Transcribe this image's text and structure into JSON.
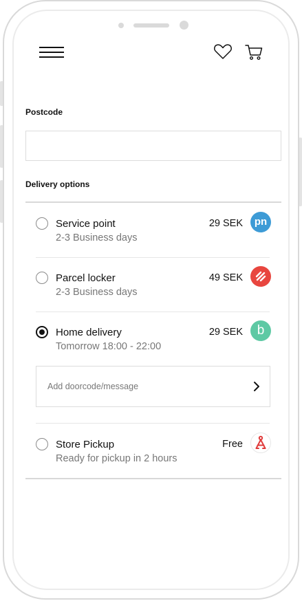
{
  "header": {
    "menu_icon": "hamburger-menu-icon",
    "favorites_icon": "heart-icon",
    "cart_icon": "shopping-cart-icon"
  },
  "postcode": {
    "label": "Postcode",
    "value": "",
    "placeholder": ""
  },
  "delivery": {
    "label": "Delivery options",
    "options": [
      {
        "title": "Service point",
        "subtitle": "2-3 Business days",
        "price": "29 SEK",
        "logo_text": "pn",
        "logo_color": "#3d9bd6",
        "selected": false
      },
      {
        "title": "Parcel locker",
        "subtitle": "2-3 Business days",
        "price": "49 SEK",
        "logo_icon": "parcel-locker-logo-icon",
        "logo_color": "#e8463f",
        "selected": false
      },
      {
        "title": "Home delivery",
        "subtitle": "Tomorrow 18:00 - 22:00",
        "price": "29 SEK",
        "logo_text": "b",
        "logo_color": "#5ec9a4",
        "selected": true
      },
      {
        "title": "Store Pickup",
        "subtitle": "Ready for pickup in 2 hours",
        "price": "Free",
        "logo_icon": "store-pickup-logo-icon",
        "logo_color": "#e03b3b",
        "selected": false
      }
    ],
    "message": {
      "placeholder": "Add doorcode/message",
      "icon": "chevron-right-icon"
    }
  }
}
